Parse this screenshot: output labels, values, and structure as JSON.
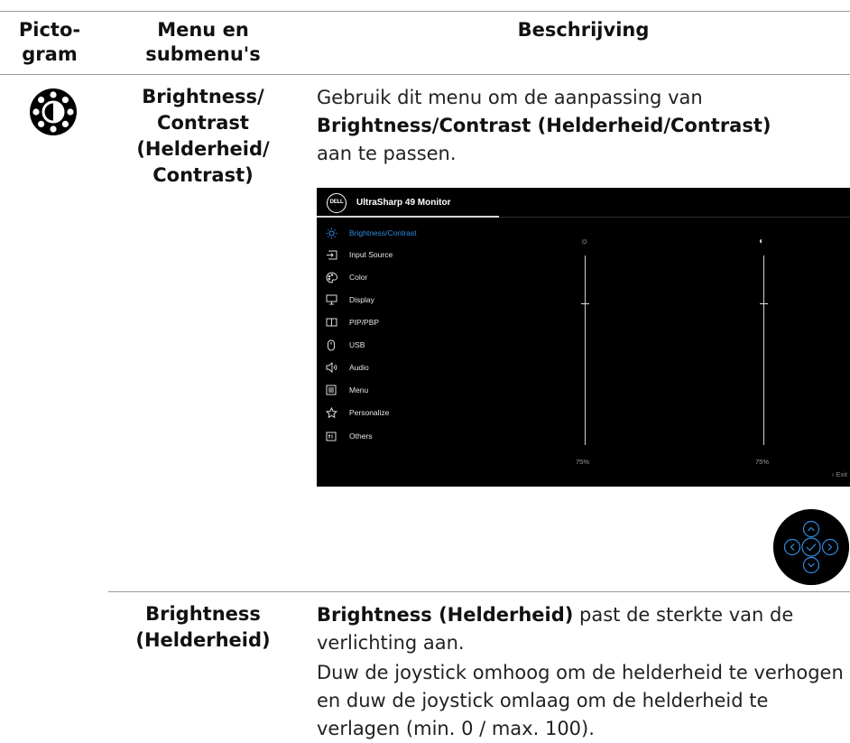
{
  "header": {
    "col1": "Picto-\ngram",
    "col2": "Menu en\nsubmenu's",
    "col3": "Beschrijving"
  },
  "rows": [
    {
      "pictogram": "brightness-contrast-icon",
      "menu": "Brightness/\nContrast\n(Helderheid/\nContrast)",
      "desc": {
        "pre": "Gebruik dit menu om de aanpassing van",
        "bold": "Brightness/Contrast (Helderheid/Contrast)",
        "post": "aan te passen."
      }
    },
    {
      "menu": "Brightness\n(Helderheid)",
      "desc_bold": "Brightness (Helderheid)",
      "desc_rest": " past de sterkte van de verlichting aan.",
      "desc2": "Duw de joystick omhoog om de helderheid te verhogen en duw de joystick omlaag om de helderheid te verlagen (min. 0 / max. 100)."
    }
  ],
  "osd": {
    "logo": "DELL",
    "title": "UltraSharp 49 Monitor",
    "menu_items": [
      {
        "label": "Brightness/Contrast",
        "icon": "brightness-icon",
        "active": true
      },
      {
        "label": "Input Source",
        "icon": "input-source-icon"
      },
      {
        "label": "Color",
        "icon": "color-palette-icon"
      },
      {
        "label": "Display",
        "icon": "display-monitor-icon"
      },
      {
        "label": "PIP/PBP",
        "icon": "pip-pbp-icon"
      },
      {
        "label": "USB",
        "icon": "usb-mouse-icon"
      },
      {
        "label": "Audio",
        "icon": "speaker-icon"
      },
      {
        "label": "Menu",
        "icon": "menu-list-icon"
      },
      {
        "label": "Personalize",
        "icon": "star-icon"
      },
      {
        "label": "Others",
        "icon": "others-icon"
      }
    ],
    "brightness_value": "75%",
    "contrast_value": "75%",
    "brightness_level": 0.75,
    "contrast_level": 0.75,
    "exit_label": "Exit",
    "accent_color": "#2e8ce0"
  },
  "joystick": {
    "buttons": [
      "up-arrow-icon",
      "left-arrow-icon",
      "check-icon",
      "right-arrow-icon",
      "down-arrow-icon"
    ],
    "color": "#2e8ce0"
  }
}
